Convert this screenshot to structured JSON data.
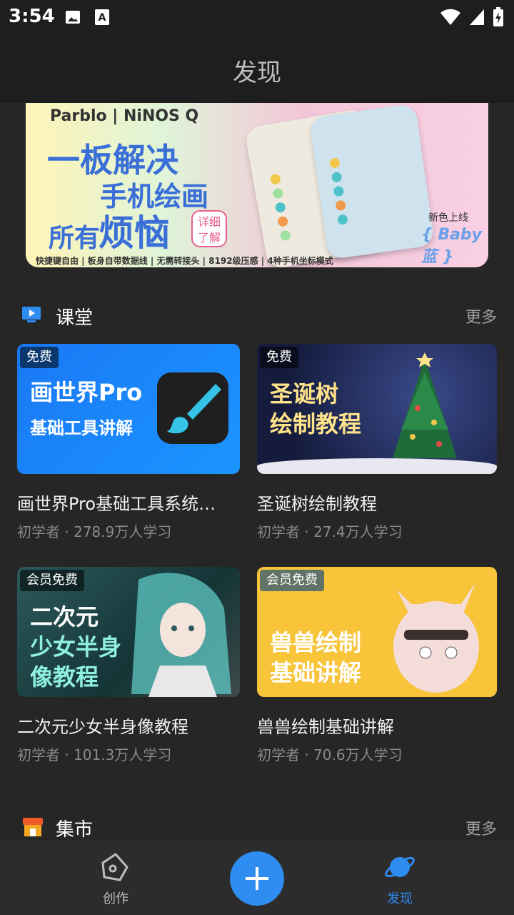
{
  "status_bar": {
    "time": "3:54",
    "icons": [
      "image-icon",
      "text-a-icon",
      "wifi-icon",
      "signal-icon",
      "battery-charging-icon"
    ]
  },
  "app_bar": {
    "title": "发现"
  },
  "banner": {
    "brand": "Parblo | NiNOS Q",
    "line1": "一板解决",
    "line2": "手机绘画",
    "line3a": "所有",
    "line3b": "烦恼",
    "detail_button": "详细了解",
    "footer": "快捷键自由 | 板身自带数据线 | 无需转接头 | 8192级压感 | 4种手机坐标模式",
    "new_color": "新色上线",
    "baby": "{ Baby蓝 }"
  },
  "classroom": {
    "title": "课堂",
    "more": "更多",
    "courses": [
      {
        "badge": "免费",
        "thumb_text": [
          "画世界Pro",
          "基础工具讲解"
        ],
        "title": "画世界Pro基础工具系统…",
        "meta": "初学者 · 278.9万人学习"
      },
      {
        "badge": "免费",
        "thumb_text": [
          "圣诞树",
          "绘制教程"
        ],
        "title": "圣诞树绘制教程",
        "meta": "初学者 · 27.4万人学习"
      },
      {
        "badge": "会员免费",
        "thumb_text": [
          "二次元",
          "少女半身",
          "像教程"
        ],
        "title": "二次元少女半身像教程",
        "meta": "初学者 · 101.3万人学习"
      },
      {
        "badge": "会员免费",
        "thumb_text": [
          "兽兽绘制",
          "基础讲解"
        ],
        "title": "兽兽绘制基础讲解",
        "meta": "初学者 · 70.6万人学习"
      }
    ]
  },
  "market": {
    "title": "集市",
    "more": "更多"
  },
  "bottom_nav": {
    "create": "创作",
    "add": "+",
    "discover": "发现",
    "active_color": "#2f8cf0"
  }
}
